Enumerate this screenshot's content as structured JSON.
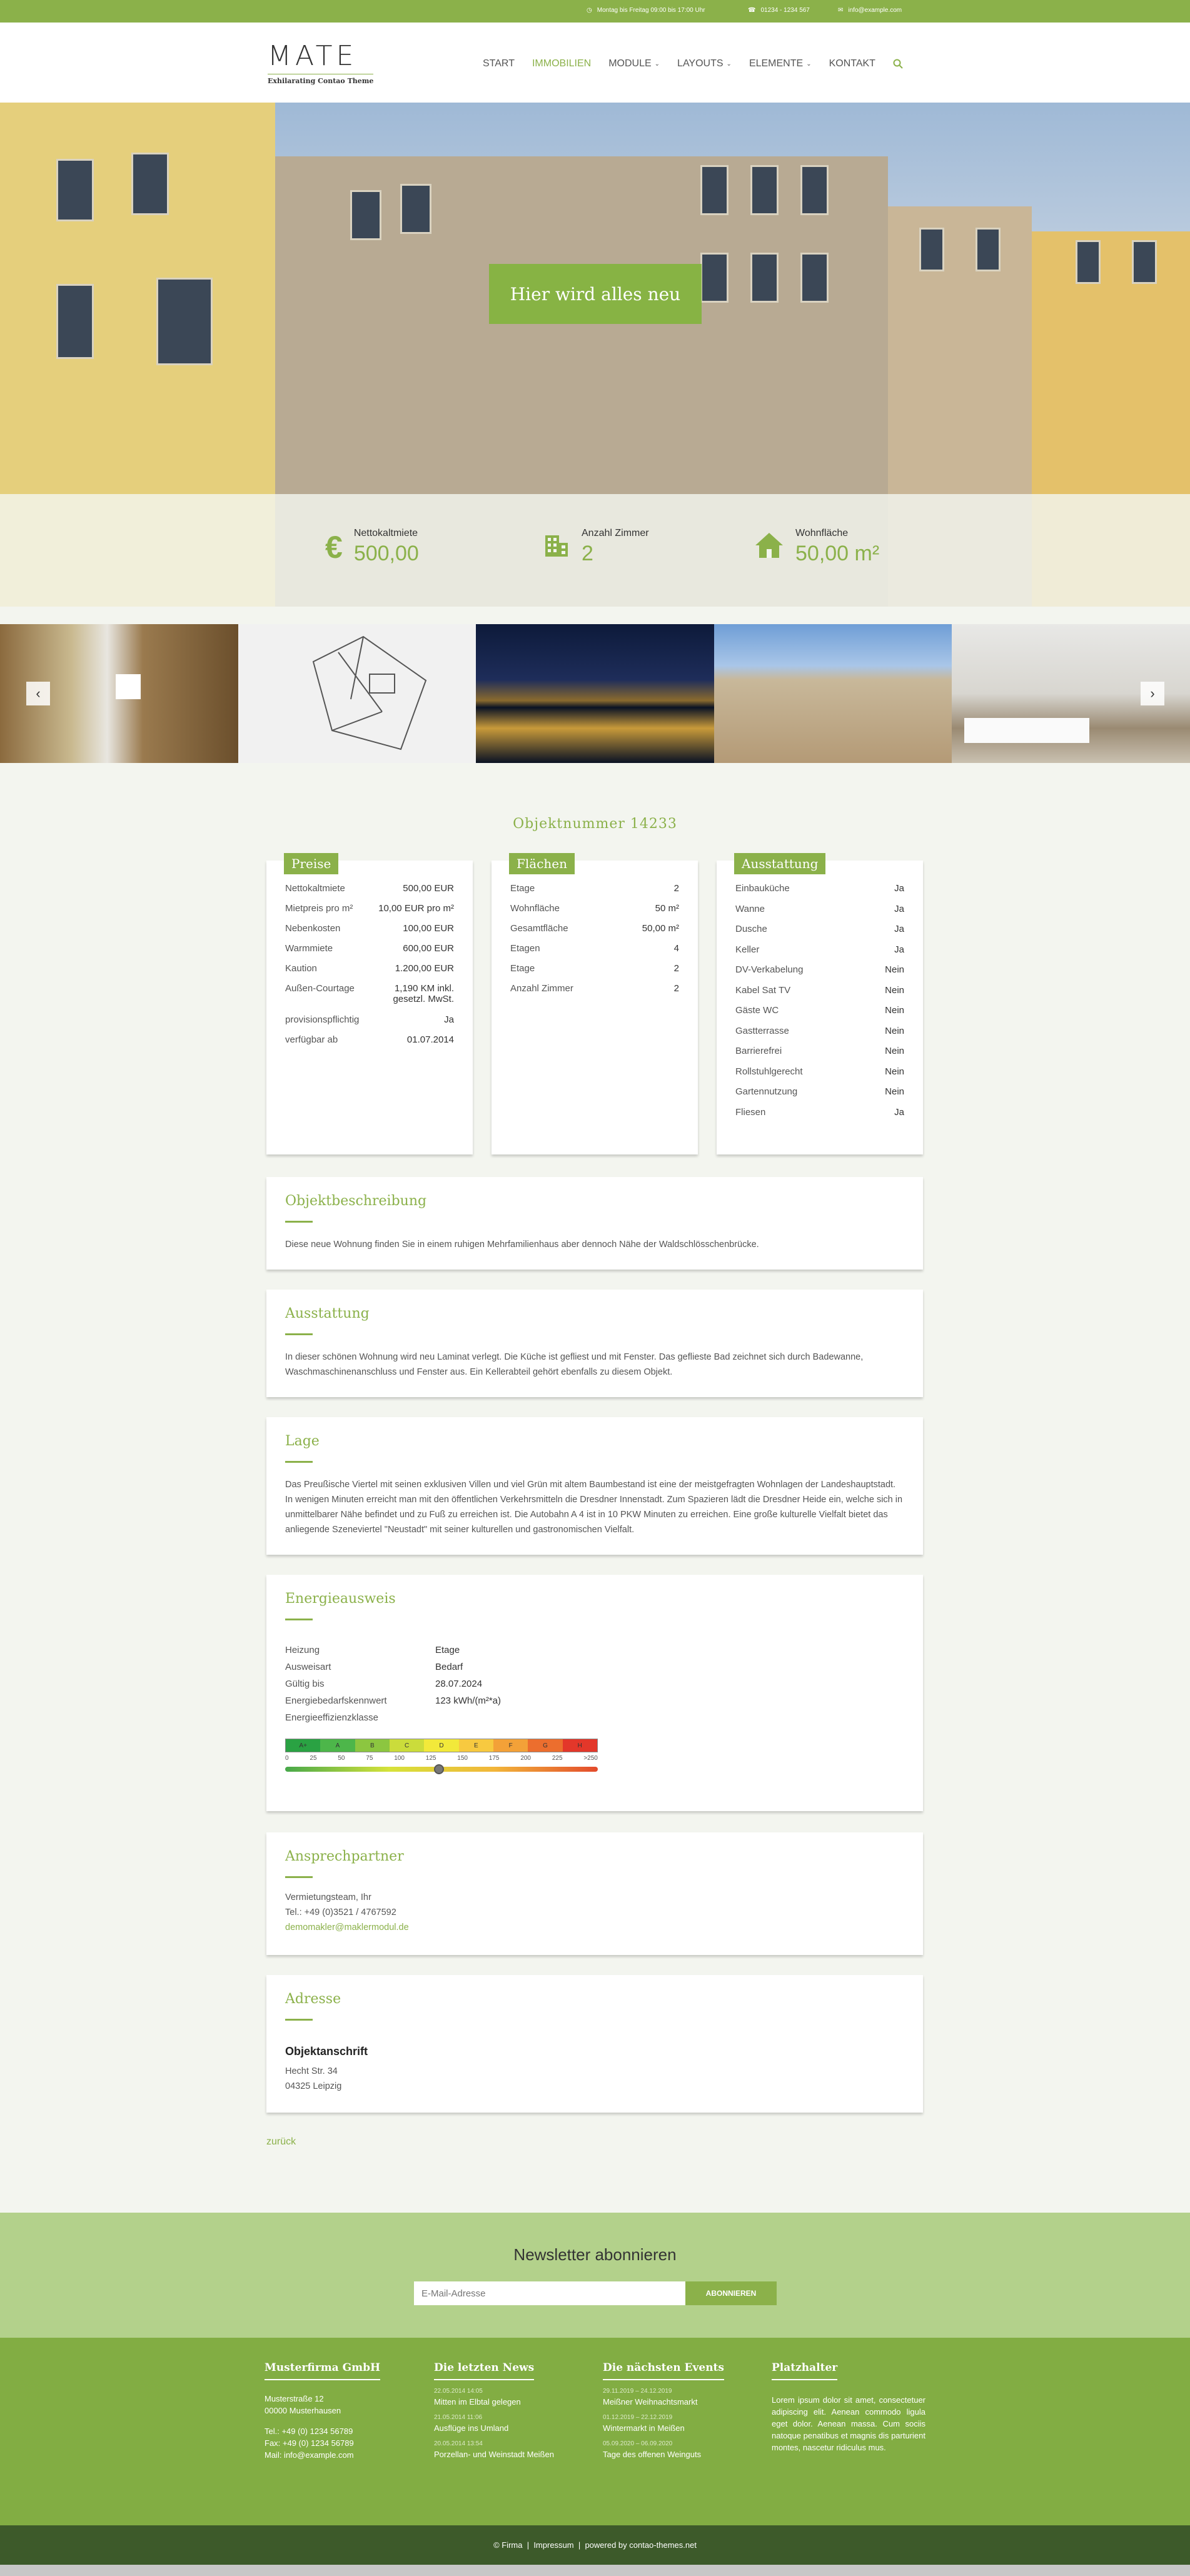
{
  "topbar": {
    "hours": "Montag bis Freitag 09:00 bis 17:00 Uhr",
    "phone": "01234 - 1234 567",
    "email": "info@example.com"
  },
  "logo": {
    "title": "MATE",
    "subtitle": "Exhilarating Contao Theme"
  },
  "nav": {
    "items": [
      "START",
      "IMMOBILIEN",
      "MODULE",
      "LAYOUTS",
      "ELEMENTE",
      "KONTAKT"
    ]
  },
  "hero": {
    "button": "Hier wird alles neu",
    "facts": [
      {
        "label": "Nettokaltmiete",
        "value": "500,00",
        "icon": "euro-icon"
      },
      {
        "label": "Anzahl Zimmer",
        "value": "2",
        "icon": "building-icon"
      },
      {
        "label": "Wohnfläche",
        "value": "50,00 m²",
        "icon": "house-icon"
      }
    ]
  },
  "gallery": {
    "prev": "‹",
    "next": "›"
  },
  "objekt": {
    "nummer": "Objektnummer 14233"
  },
  "preise": {
    "title": "Preise",
    "rows": [
      {
        "k": "Nettokaltmiete",
        "v": "500,00 EUR"
      },
      {
        "k": "Mietpreis pro m²",
        "v": "10,00 EUR pro m²"
      },
      {
        "k": "Nebenkosten",
        "v": "100,00 EUR"
      },
      {
        "k": "Warmmiete",
        "v": "600,00 EUR"
      },
      {
        "k": "Kaution",
        "v": "1.200,00 EUR"
      },
      {
        "k": "Außen-Courtage",
        "v": "1,190 KM inkl. gesetzl. MwSt."
      },
      {
        "k": "provisionspflichtig",
        "v": "Ja"
      },
      {
        "k": "verfügbar ab",
        "v": "01.07.2014"
      }
    ]
  },
  "flaechen": {
    "title": "Flächen",
    "rows": [
      {
        "k": "Etage",
        "v": "2"
      },
      {
        "k": "Wohnfläche",
        "v": "50 m²"
      },
      {
        "k": "Gesamtfläche",
        "v": "50,00 m²"
      },
      {
        "k": "Etagen",
        "v": "4"
      },
      {
        "k": "Etage",
        "v": "2"
      },
      {
        "k": "Anzahl Zimmer",
        "v": "2"
      }
    ]
  },
  "ausstattung_card": {
    "title": "Ausstattung",
    "rows": [
      {
        "k": "Einbauküche",
        "v": "Ja"
      },
      {
        "k": "Wanne",
        "v": "Ja"
      },
      {
        "k": "Dusche",
        "v": "Ja"
      },
      {
        "k": "Keller",
        "v": "Ja"
      },
      {
        "k": "DV-Verkabelung",
        "v": "Nein"
      },
      {
        "k": "Kabel Sat TV",
        "v": "Nein"
      },
      {
        "k": "Gäste WC",
        "v": "Nein"
      },
      {
        "k": "Gastterrasse",
        "v": "Nein"
      },
      {
        "k": "Barrierefrei",
        "v": "Nein"
      },
      {
        "k": "Rollstuhlgerecht",
        "v": "Nein"
      },
      {
        "k": "Gartennutzung",
        "v": "Nein"
      },
      {
        "k": "Fliesen",
        "v": "Ja"
      }
    ]
  },
  "beschreibung": {
    "title": "Objektbeschreibung",
    "text": "Diese neue Wohnung finden Sie in einem ruhigen Mehrfamilienhaus aber dennoch Nähe der Waldschlösschenbrücke."
  },
  "ausstattung": {
    "title": "Ausstattung",
    "text": "In dieser schönen Wohnung wird neu Laminat verlegt. Die Küche ist gefliest und mit Fenster. Das geflieste Bad zeichnet sich durch Badewanne, Waschmaschinenanschluss und Fenster aus. Ein Kellerabteil gehört ebenfalls zu diesem Objekt."
  },
  "lage": {
    "title": "Lage",
    "text": "Das Preußische Viertel mit seinen exklusiven Villen und viel Grün mit altem Baumbestand ist eine der meistgefragten Wohnlagen der Landeshauptstadt. In wenigen Minuten erreicht man mit den öffentlichen Verkehrsmitteln die Dresdner Innenstadt. Zum Spazieren lädt die Dresdner Heide ein, welche sich in unmittelbarer Nähe befindet und zu Fuß zu erreichen ist. Die Autobahn A 4 ist in 10 PKW Minuten zu erreichen. Eine große kulturelle Vielfalt bietet das anliegende Szeneviertel \"Neustadt\" mit seiner kulturellen und gastronomischen Vielfalt."
  },
  "energie": {
    "title": "Energieausweis",
    "rows": [
      {
        "k": "Heizung",
        "v": "Etage"
      },
      {
        "k": "Ausweisart",
        "v": "Bedarf"
      },
      {
        "k": "Gültig bis",
        "v": "28.07.2024"
      },
      {
        "k": "Energiebedarfskennwert",
        "v": "123 kWh/(m²*a)"
      },
      {
        "k": "Energieeffizienzklasse",
        "v": ""
      }
    ],
    "classes": [
      "A+",
      "A",
      "B",
      "C",
      "D",
      "E",
      "F",
      "G",
      "H"
    ],
    "class_colors": [
      "#2aa243",
      "#4db64a",
      "#8cc640",
      "#cbdc3b",
      "#f2e93a",
      "#f7c940",
      "#f3a138",
      "#ec6e2e",
      "#e3372a"
    ],
    "ticks": [
      "0",
      "25",
      "50",
      "75",
      "100",
      "125",
      "150",
      "175",
      "200",
      "225",
      ">250"
    ],
    "value": 123
  },
  "ansprech": {
    "title": "Ansprechpartner",
    "name": "Vermietungsteam, Ihr",
    "tel": "Tel.: +49 (0)3521 / 4767592",
    "email": "demomakler@maklermodul.de"
  },
  "adresse": {
    "title": "Adresse",
    "heading": "Objektanschrift",
    "street": "Hecht Str. 34",
    "city": "04325 Leipzig"
  },
  "back": "zurück",
  "newsletter": {
    "title": "Newsletter abonnieren",
    "placeholder": "E-Mail-Adresse",
    "button": "ABONNIEREN"
  },
  "footer": {
    "col1": {
      "title": "Musterfirma GmbH",
      "street": "Musterstraße 12",
      "city": "00000 Musterhausen",
      "tel": "Tel.: +49 (0) 1234 56789",
      "fax": "Fax: +49 (0) 1234 56789",
      "mail": "Mail: info@example.com"
    },
    "col2": {
      "title": "Die letzten News",
      "items": [
        {
          "date": "22.05.2014 14:05",
          "text": "Mitten im Elbtal gelegen"
        },
        {
          "date": "21.05.2014 11:06",
          "text": "Ausflüge ins Umland"
        },
        {
          "date": "20.05.2014 13:54",
          "text": "Porzellan- und Weinstadt Meißen"
        }
      ]
    },
    "col3": {
      "title": "Die nächsten Events",
      "items": [
        {
          "date": "29.11.2019 – 24.12.2019",
          "text": "Meißner Weihnachtsmarkt"
        },
        {
          "date": "01.12.2019 – 22.12.2019",
          "text": "Wintermarkt in Meißen"
        },
        {
          "date": "05.09.2020 – 06.09.2020",
          "text": "Tage des offenen Weinguts"
        }
      ]
    },
    "col4": {
      "title": "Platzhalter",
      "text": "Lorem ipsum dolor sit amet, consectetuer adipiscing elit. Aenean commodo ligula eget dolor. Aenean massa. Cum sociis natoque penatibus et magnis dis parturient montes, nascetur ridiculus mus."
    }
  },
  "bottom": {
    "firma": "© Firma",
    "impressum": "Impressum",
    "powered": "powered by contao-themes.net"
  }
}
